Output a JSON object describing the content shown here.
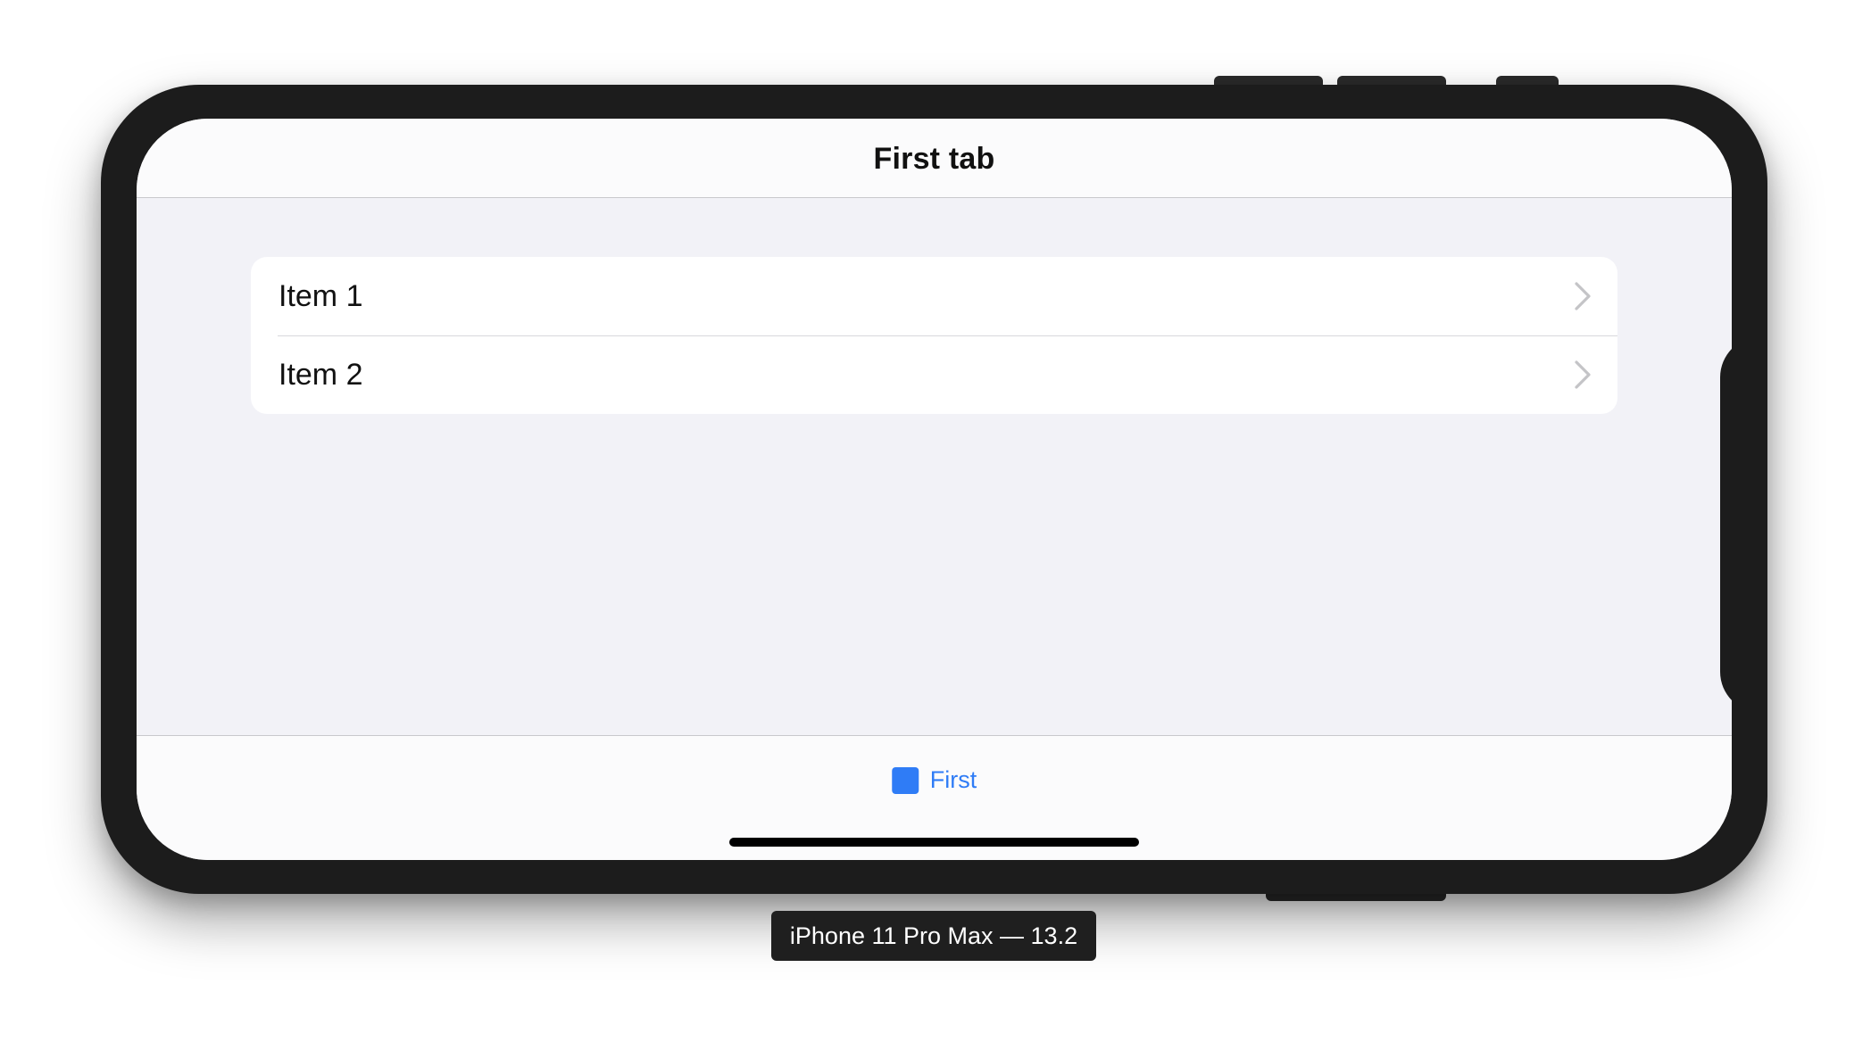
{
  "navbar": {
    "title": "First tab"
  },
  "list": {
    "items": [
      {
        "label": "Item 1"
      },
      {
        "label": "Item 2"
      }
    ]
  },
  "tabbar": {
    "tabs": [
      {
        "label": "First",
        "icon": "square-icon",
        "selected": true
      }
    ]
  },
  "simulator": {
    "device_label": "iPhone 11 Pro Max — 13.2"
  },
  "colors": {
    "accent": "#2f7cf6",
    "background": "#f2f2f7",
    "device_frame": "#1c1c1c"
  }
}
